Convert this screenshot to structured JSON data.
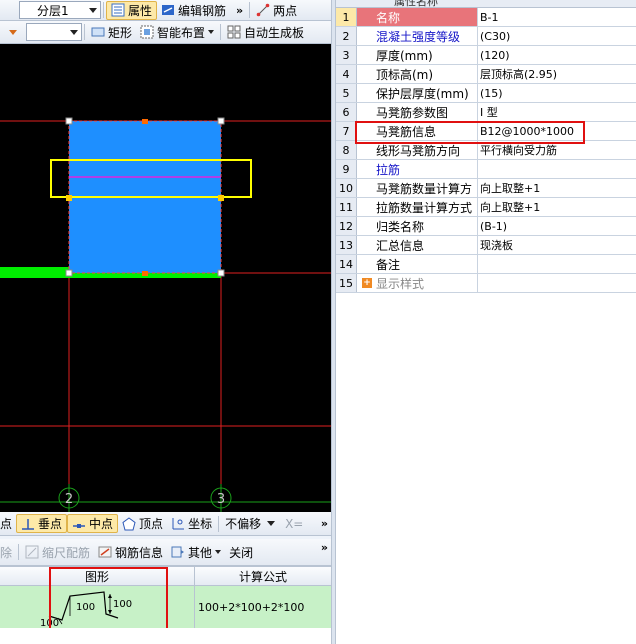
{
  "toolbar1": {
    "floor_value": "分层1",
    "properties_label": "属性",
    "edit_rebar_label": "编辑钢筋",
    "two_points_label": "两点"
  },
  "toolbar2": {
    "rect_label": "矩形",
    "smart_layout_label": "智能布置",
    "auto_generate_label": "自动生成板"
  },
  "canvas": {
    "axis_labels": [
      "2",
      "3"
    ],
    "colors": {
      "background": "#000000",
      "slab": "#1e8fff",
      "highlight_box": "#ffff00",
      "green_bar": "#00ff00",
      "grid_line": "#ff2020"
    }
  },
  "snap_toolbar": {
    "endpoint_label": "点",
    "perpendicular_label": "垂点",
    "midpoint_label": "中点",
    "vertex_label": "顶点",
    "coordinate_label": "坐标",
    "offset_value": "不偏移",
    "x_label": "X="
  },
  "rebar_toolbar": {
    "delete_label": "除",
    "scale_label": "缩尺配筋",
    "rebar_info_label": "钢筋信息",
    "other_label": "其他",
    "close_label": "关闭"
  },
  "rebar_grid": {
    "col_shape": "图形",
    "col_formula": "计算公式",
    "shape_dims": [
      "100",
      "100",
      "100"
    ],
    "formula": "100+2*100+2*100"
  },
  "properties": {
    "header_label": "属性名称",
    "rows": [
      {
        "num": "1",
        "name": "名称",
        "value": "B-1"
      },
      {
        "num": "2",
        "name": "混凝土强度等级",
        "value": "(C30)"
      },
      {
        "num": "3",
        "name": "厚度(mm)",
        "value": "(120)"
      },
      {
        "num": "4",
        "name": "顶标高(m)",
        "value": "层顶标高(2.95)"
      },
      {
        "num": "5",
        "name": "保护层厚度(mm)",
        "value": "(15)"
      },
      {
        "num": "6",
        "name": "马凳筋参数图",
        "value": "I 型"
      },
      {
        "num": "7",
        "name": "马凳筋信息",
        "value": "B12@1000*1000"
      },
      {
        "num": "8",
        "name": "线形马凳筋方向",
        "value": "平行横向受力筋"
      },
      {
        "num": "9",
        "name": "拉筋",
        "value": ""
      },
      {
        "num": "10",
        "name": "马凳筋数量计算方",
        "value": "向上取整+1"
      },
      {
        "num": "11",
        "name": "拉筋数量计算方式",
        "value": "向上取整+1"
      },
      {
        "num": "12",
        "name": "归类名称",
        "value": "(B-1)"
      },
      {
        "num": "13",
        "name": "汇总信息",
        "value": "现浇板"
      },
      {
        "num": "14",
        "name": "备注",
        "value": ""
      },
      {
        "num": "15",
        "name": "显示样式",
        "value": ""
      }
    ]
  }
}
